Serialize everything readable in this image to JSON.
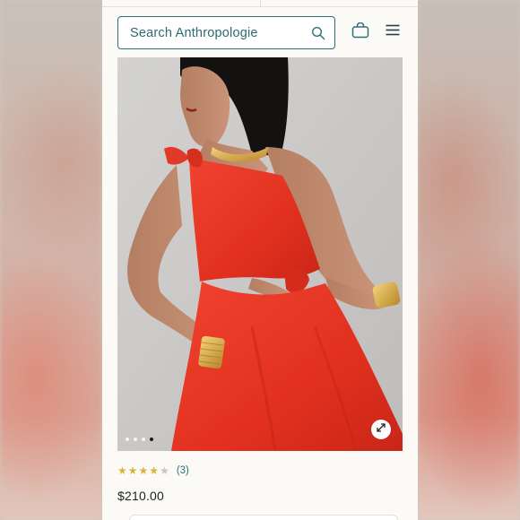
{
  "search": {
    "placeholder": "Search Anthropologie"
  },
  "icons": {
    "search": "search-icon",
    "bag": "shopping-bag-icon",
    "menu": "hamburger-menu-icon",
    "expand": "expand-arrows-icon"
  },
  "product": {
    "rating": 4,
    "rating_max": 5,
    "review_count": "(3)",
    "price": "$210.00"
  },
  "gallery": {
    "total_images": 4,
    "active_index": 3
  },
  "colors": {
    "brand_teal": "#2f6f77",
    "star_gold": "#d9b43a",
    "dress_red": "#e8392a",
    "page_bg": "#fbfaf7"
  }
}
